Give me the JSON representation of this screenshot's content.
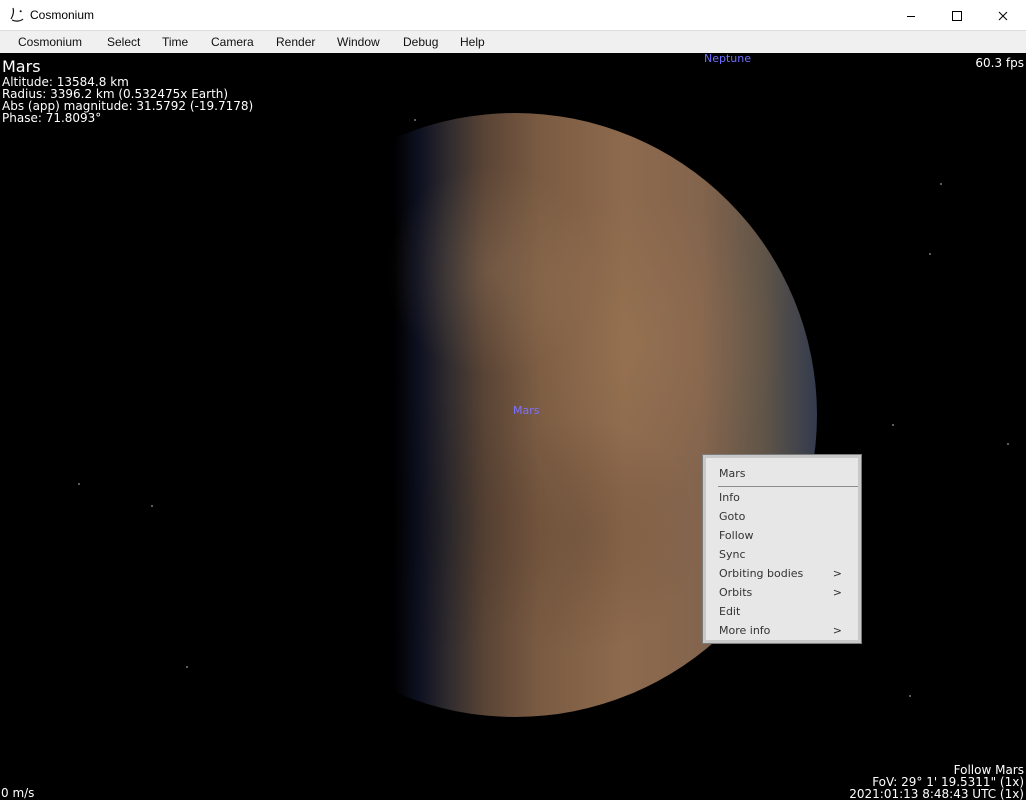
{
  "window": {
    "title": "Cosmonium",
    "minimize_icon": "minimize-icon",
    "maximize_icon": "maximize-icon",
    "close_icon": "close-icon"
  },
  "menu": [
    "Cosmonium",
    "Select",
    "Time",
    "Camera",
    "Render",
    "Window",
    "Debug",
    "Help"
  ],
  "hud": {
    "selected_name": "Mars",
    "altitude": "Altitude: 13584.8 km",
    "radius": "Radius: 3396.2 km (0.532475x Earth)",
    "magnitude": "Abs (app) magnitude: 31.5792 (-19.7178)",
    "phase": "Phase: 71.8093°",
    "fps": "60.3 fps",
    "speed": "0 m/s",
    "follow": "Follow Mars",
    "fov": "FoV: 29° 1' 19.5311\" (1x)",
    "datetime": "2021:01:13  8:48:43 UTC (1x)"
  },
  "scene": {
    "planet_label": "Mars",
    "neptune_label": "Neptune"
  },
  "context_menu": {
    "title": "Mars",
    "items": [
      "Info",
      "Goto",
      "Follow",
      "Sync",
      "Orbiting bodies",
      "Orbits",
      "Edit",
      "More info"
    ],
    "submenu_arrow": ">"
  }
}
